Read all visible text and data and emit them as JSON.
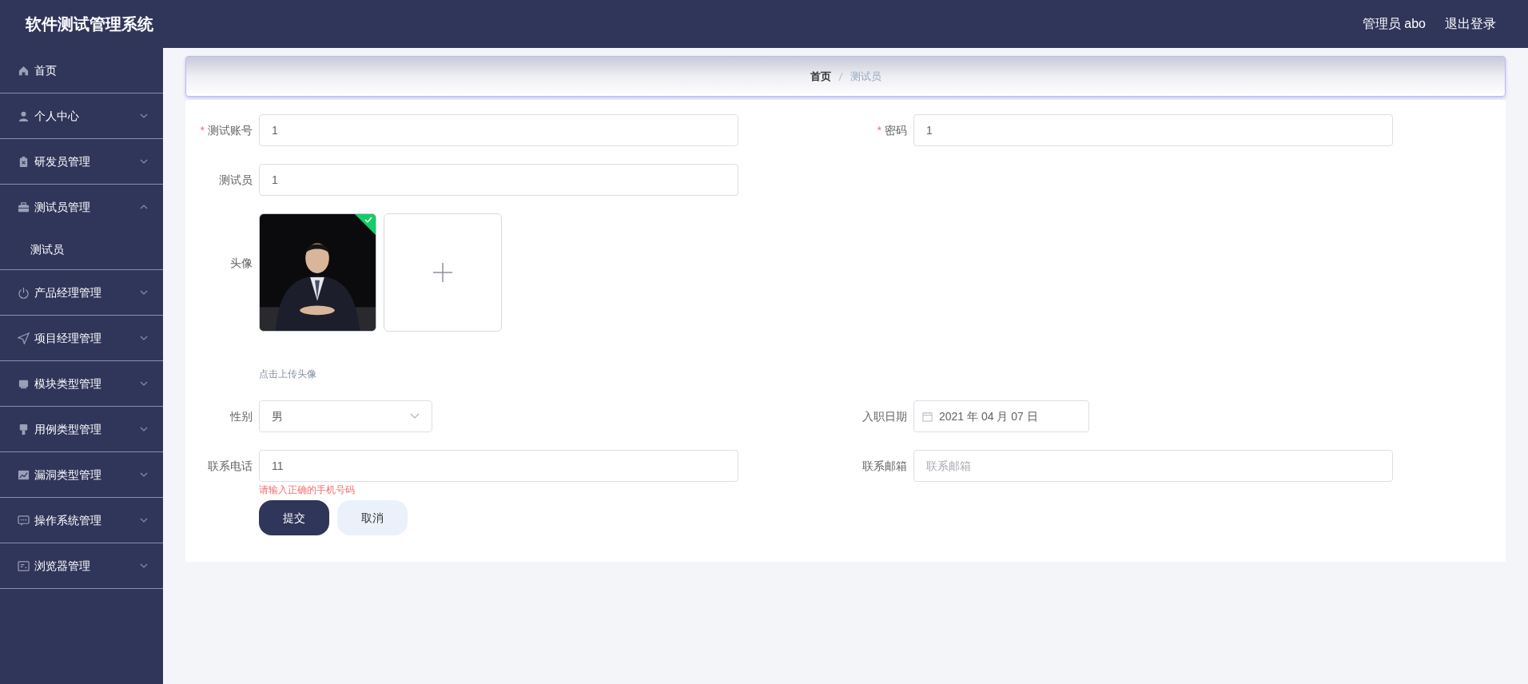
{
  "header": {
    "title": "软件测试管理系统",
    "user": "管理员 abo",
    "logout": "退出登录"
  },
  "sidebar": {
    "items": [
      {
        "label": "首页",
        "kind": "link"
      },
      {
        "label": "个人中心",
        "kind": "submenu",
        "expanded": false
      },
      {
        "label": "研发员管理",
        "kind": "submenu",
        "expanded": false
      },
      {
        "label": "测试员管理",
        "kind": "submenu",
        "expanded": true,
        "children": [
          {
            "label": "测试员"
          }
        ]
      },
      {
        "label": "产品经理管理",
        "kind": "submenu",
        "expanded": false
      },
      {
        "label": "项目经理管理",
        "kind": "submenu",
        "expanded": false
      },
      {
        "label": "模块类型管理",
        "kind": "submenu",
        "expanded": false
      },
      {
        "label": "用例类型管理",
        "kind": "submenu",
        "expanded": false
      },
      {
        "label": "漏洞类型管理",
        "kind": "submenu",
        "expanded": false
      },
      {
        "label": "操作系统管理",
        "kind": "submenu",
        "expanded": false
      },
      {
        "label": "浏览器管理",
        "kind": "submenu",
        "expanded": false
      }
    ]
  },
  "breadcrumb": [
    "首页",
    "测试员"
  ],
  "form": {
    "rows": [
      [
        {
          "kind": "input",
          "label": "测试账号",
          "required_mark": "*",
          "value": "1"
        },
        {
          "kind": "input",
          "label": "密码",
          "required_mark": "*",
          "value": "1"
        }
      ],
      [
        {
          "kind": "input",
          "label": "测试员",
          "value": "1"
        }
      ],
      [
        {
          "kind": "upload",
          "label": "头像",
          "uploaded": true,
          "hint": "点击上传头像"
        }
      ],
      [
        {
          "kind": "select",
          "label": "性别",
          "value": "男"
        },
        {
          "kind": "date",
          "label": "入职日期",
          "value": "2021 年 04 月 07 日"
        }
      ],
      [
        {
          "kind": "input",
          "label": "联系电话",
          "value": "11",
          "error": "请输入正确的手机号码"
        },
        {
          "kind": "input",
          "label": "联系邮箱",
          "placeholder": "联系邮箱"
        }
      ]
    ],
    "buttons": [
      {
        "label": "提交",
        "kind": "primary"
      },
      {
        "label": "取消",
        "kind": "secondary"
      }
    ]
  }
}
